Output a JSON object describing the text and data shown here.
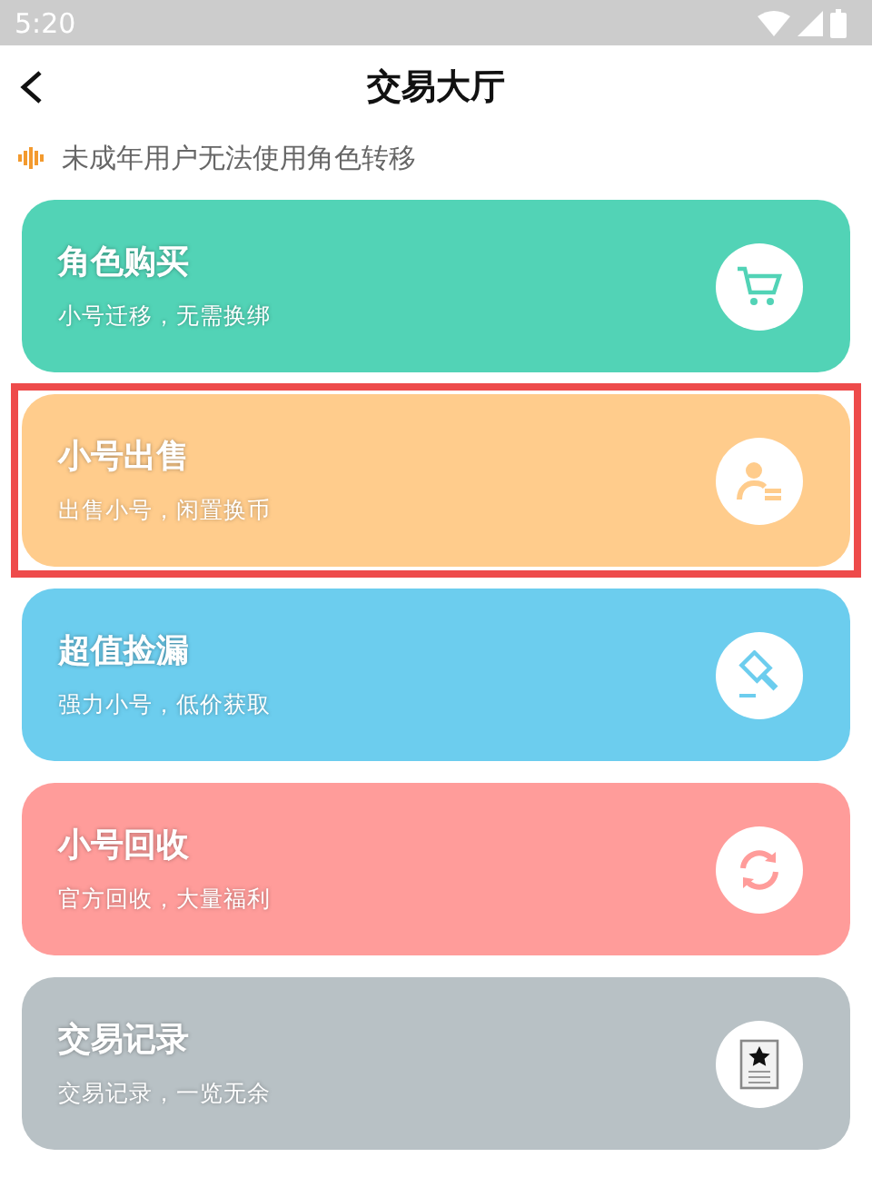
{
  "status_bar": {
    "time": "5:20"
  },
  "header": {
    "title": "交易大厅"
  },
  "notice": {
    "text": "未成年用户无法使用角色转移"
  },
  "cards": [
    {
      "title": "角色购买",
      "subtitle": "小号迁移，无需换绑",
      "color": "#52d3b6",
      "highlighted": false
    },
    {
      "title": "小号出售",
      "subtitle": "出售小号，闲置换币",
      "color": "#ffcc8c",
      "highlighted": true
    },
    {
      "title": "超值捡漏",
      "subtitle": "强力小号，低价获取",
      "color": "#6ccdee",
      "highlighted": false
    },
    {
      "title": "小号回收",
      "subtitle": "官方回收，大量福利",
      "color": "#ff9c9a",
      "highlighted": false
    },
    {
      "title": "交易记录",
      "subtitle": "交易记录，一览无余",
      "color": "#b8c1c5",
      "highlighted": false
    }
  ]
}
